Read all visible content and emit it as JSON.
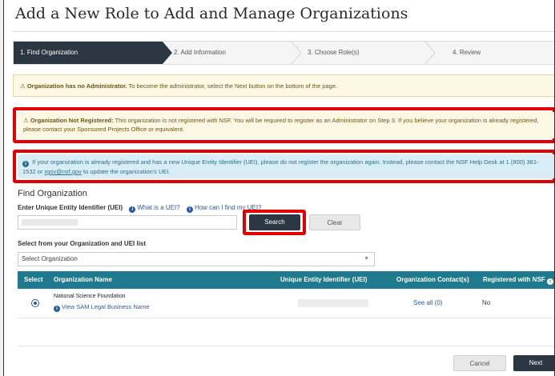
{
  "page": {
    "title": "Add a New Role to Add and Manage Organizations"
  },
  "stepper": {
    "steps": [
      {
        "label": "1. Find Organization",
        "active": true
      },
      {
        "label": "2. Add Information",
        "active": false
      },
      {
        "label": "3. Choose Role(s)",
        "active": false
      },
      {
        "label": "4. Review",
        "active": false
      }
    ]
  },
  "alerts": {
    "no_admin": {
      "icon": "warning-icon",
      "strong": "Organization has no Administrator.",
      "text": " To become the administrator, select the Next button on the bottom of the page."
    },
    "not_registered": {
      "icon": "warning-icon",
      "strong": "Organization Not Registered:",
      "text": " This organization is not registered with NSF. You will be required to register as an Administrator on Step 3. If you believe your organization is already registered, please contact your Sponsored Projects Office or equivalent."
    },
    "uei_info": {
      "icon": "info-icon",
      "text_before": " If your organization is already registered and has a new Unique Entity Identifier (UEI), please do not register the organization again. Instead, please contact the NSF Help Desk at 1 (800) 381-1532 or ",
      "email": "rgov@nsf.gov",
      "text_after": " to update the organization's UEI."
    }
  },
  "find_org": {
    "heading": "Find Organization",
    "uei_label": "Enter Unique Entity Identifier (UEI)",
    "what_is_uei": "What is a UEI?",
    "how_find_uei": "How can I find my UEI?",
    "search_button": "Search",
    "clear_button": "Clear",
    "select_label": "Select from your Organization and UEI list",
    "select_value": "Select Organization"
  },
  "table": {
    "headers": [
      "Select",
      "Organization Name",
      "Unique Entity Identifier (UEI)",
      "Organization Contact(s)",
      "Registered with NSF"
    ],
    "rows": [
      {
        "selected": true,
        "org_name": "National Science Foundation",
        "sam_link": "View SAM Legal Business Name",
        "contacts": "See all (0)",
        "registered": "No"
      }
    ]
  },
  "footer": {
    "cancel_button": "Cancel",
    "next_button": "Next"
  },
  "colors": {
    "dark": "#2b3742",
    "table_header": "#1e7a8c",
    "highlight_red": "#e00000",
    "warning_bg": "#fcf8e3",
    "info_bg": "#d9edf7"
  }
}
